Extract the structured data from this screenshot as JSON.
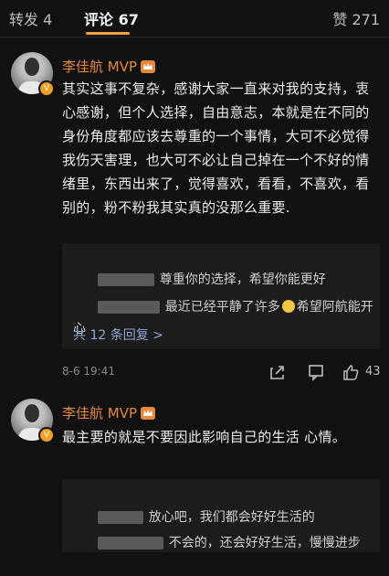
{
  "tabs": {
    "repost_label": "转发",
    "repost_count": "4",
    "comment_label": "评论",
    "comment_count": "67",
    "like_label": "赞",
    "like_count": "271"
  },
  "comments": [
    {
      "name": "李佳航 MVP",
      "text": "其实这事不复杂，感谢大家一直来对我的支持，衷心感谢，但个人选择，自由意志，本就是在不同的身份角度都应该去尊重的一个事情，大可不必觉得我伤天害理，也大可不必让自己掉在一个不好的情绪里，东西出来了，觉得喜欢，看看，不喜欢，看别的，粉不粉我其实真的没那么重要.",
      "replies": [
        {
          "text": "尊重你的选择，希望你能更好"
        },
        {
          "text": "最近已经平静了许多",
          "text_after_emoji": "希望阿航能开心"
        }
      ],
      "more_replies": "共 12 条回复 >",
      "time": "8-6 19:41",
      "likes": "43"
    },
    {
      "name": "李佳航 MVP",
      "text": "最主要的就是不要因此影响自己的生活 心情。",
      "replies": [
        {
          "text": "放心吧，我们都会好好生活的"
        },
        {
          "text": "不会的，还会好好生活，慢慢进步"
        }
      ]
    }
  ],
  "colors": {
    "accent": "#e8893a",
    "link": "#8fa7d6",
    "background": "#111111"
  }
}
